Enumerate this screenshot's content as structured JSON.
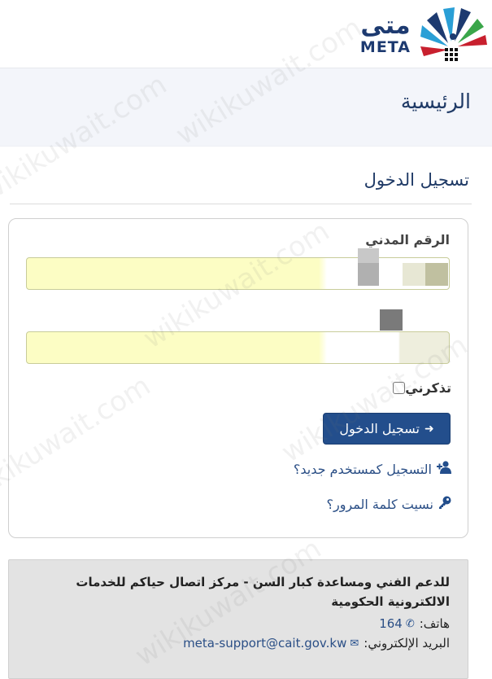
{
  "header": {
    "logo_arabic": "متى",
    "logo_english": "META"
  },
  "nav": {
    "home": "الرئيسية"
  },
  "page": {
    "title": "تسجيل الدخول"
  },
  "form": {
    "civil_id_label": "الرقم المدني",
    "civil_id_value": "",
    "password_value": "",
    "remember_label": "تذكرني",
    "remember_checked": false,
    "login_button": "تسجيل الدخول",
    "register_link": "التسجيل كمستخدم جديد؟",
    "forgot_link": "نسيت كلمة المرور؟"
  },
  "support": {
    "title": "للدعم الفني ومساعدة كبار السن - مركز اتصال حياكم للخدمات الالكترونية الحكومية",
    "phone_label": "هاتف:",
    "phone_value": "164",
    "email_label": "البريد الإلكتروني:",
    "email_value": "meta-support@cait.gov.kw"
  },
  "watermark": "wikikuwait.com",
  "colors": {
    "primary": "#234e8c",
    "heading": "#1f3a66",
    "autofill": "#fcfdc4",
    "support_bg": "#e3e3e3"
  },
  "icons": {
    "login": "sign-in-icon",
    "register": "user-plus-icon",
    "forgot": "key-icon",
    "phone": "phone-icon",
    "email": "envelope-icon"
  }
}
